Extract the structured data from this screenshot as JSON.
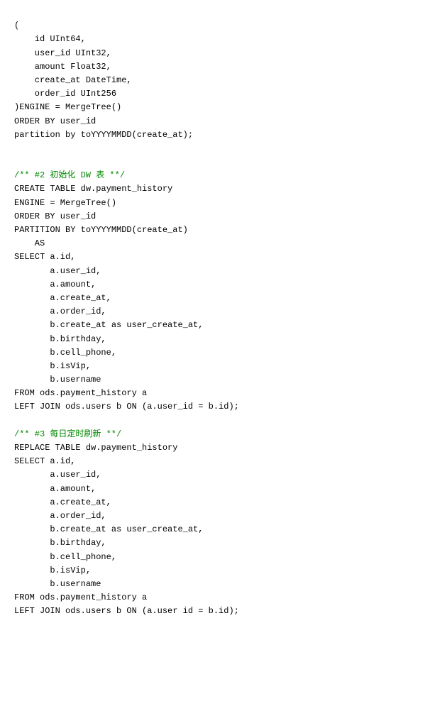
{
  "code": {
    "lines": [
      {
        "text": "("
      },
      {
        "text": "    id UInt64,"
      },
      {
        "text": "    user_id UInt32,"
      },
      {
        "text": "    amount Float32,"
      },
      {
        "text": "    create_at DateTime,"
      },
      {
        "text": "    order_id UInt256"
      },
      {
        "text": ")ENGINE = MergeTree()"
      },
      {
        "text": "ORDER BY user_id"
      },
      {
        "text": "partition by toYYYYMMDD(create_at);"
      },
      {
        "text": ""
      },
      {
        "text": ""
      },
      {
        "text": "/** #2 初始化 DW 表 **/",
        "comment": true
      },
      {
        "text": "CREATE TABLE dw.payment_history"
      },
      {
        "text": "ENGINE = MergeTree()"
      },
      {
        "text": "ORDER BY user_id"
      },
      {
        "text": "PARTITION BY toYYYYMMDD(create_at)"
      },
      {
        "text": "    AS"
      },
      {
        "text": "SELECT a.id,"
      },
      {
        "text": "       a.user_id,"
      },
      {
        "text": "       a.amount,"
      },
      {
        "text": "       a.create_at,"
      },
      {
        "text": "       a.order_id,"
      },
      {
        "text": "       b.create_at as user_create_at,"
      },
      {
        "text": "       b.birthday,"
      },
      {
        "text": "       b.cell_phone,"
      },
      {
        "text": "       b.isVip,"
      },
      {
        "text": "       b.username"
      },
      {
        "text": "FROM ods.payment_history a"
      },
      {
        "text": "LEFT JOIN ods.users b ON (a.user_id = b.id);"
      },
      {
        "text": ""
      },
      {
        "text": "/** #3 每日定时刷新 **/",
        "comment": true
      },
      {
        "text": "REPLACE TABLE dw.payment_history"
      },
      {
        "text": "SELECT a.id,"
      },
      {
        "text": "       a.user_id,"
      },
      {
        "text": "       a.amount,"
      },
      {
        "text": "       a.create_at,"
      },
      {
        "text": "       a.order_id,"
      },
      {
        "text": "       b.create_at as user_create_at,"
      },
      {
        "text": "       b.birthday,"
      },
      {
        "text": "       b.cell_phone,"
      },
      {
        "text": "       b.isVip,"
      },
      {
        "text": "       b.username"
      },
      {
        "text": "FROM ods.payment_history a"
      },
      {
        "text": "LEFT JOIN ods.users b ON (a.user id = b.id);"
      }
    ]
  }
}
